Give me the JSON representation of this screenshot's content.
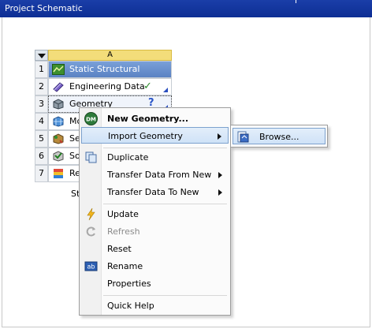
{
  "window": {
    "title": "Project Schematic"
  },
  "system": {
    "column_letter": "A",
    "rows": [
      {
        "num": "1",
        "label": "Static Structural",
        "icon": "static-structural-icon"
      },
      {
        "num": "2",
        "label": "Engineering Data",
        "icon": "engineering-data-icon",
        "status": "✓"
      },
      {
        "num": "3",
        "label": "Geometry",
        "icon": "geometry-icon",
        "status": "?"
      },
      {
        "num": "4",
        "label": "Mo",
        "icon": "model-icon"
      },
      {
        "num": "5",
        "label": "Se",
        "icon": "setup-icon"
      },
      {
        "num": "6",
        "label": "So",
        "icon": "solution-icon"
      },
      {
        "num": "7",
        "label": "Re",
        "icon": "results-icon"
      }
    ],
    "below_label": "St"
  },
  "context_menu": {
    "new_geometry": "New Geometry...",
    "import_geometry": "Import Geometry",
    "duplicate": "Duplicate",
    "transfer_from_new": "Transfer Data From New",
    "transfer_to_new": "Transfer Data To New",
    "update": "Update",
    "refresh": "Refresh",
    "reset": "Reset",
    "rename": "Rename",
    "properties": "Properties",
    "quick_help": "Quick Help",
    "dm_badge": "DM"
  },
  "submenu": {
    "browse": "Browse..."
  },
  "colors": {
    "title_bar": "#0d2e94",
    "column_header": "#f3dd7a",
    "title_cell": "#5a82c3",
    "menu_highlight": "#cfe2f7"
  }
}
